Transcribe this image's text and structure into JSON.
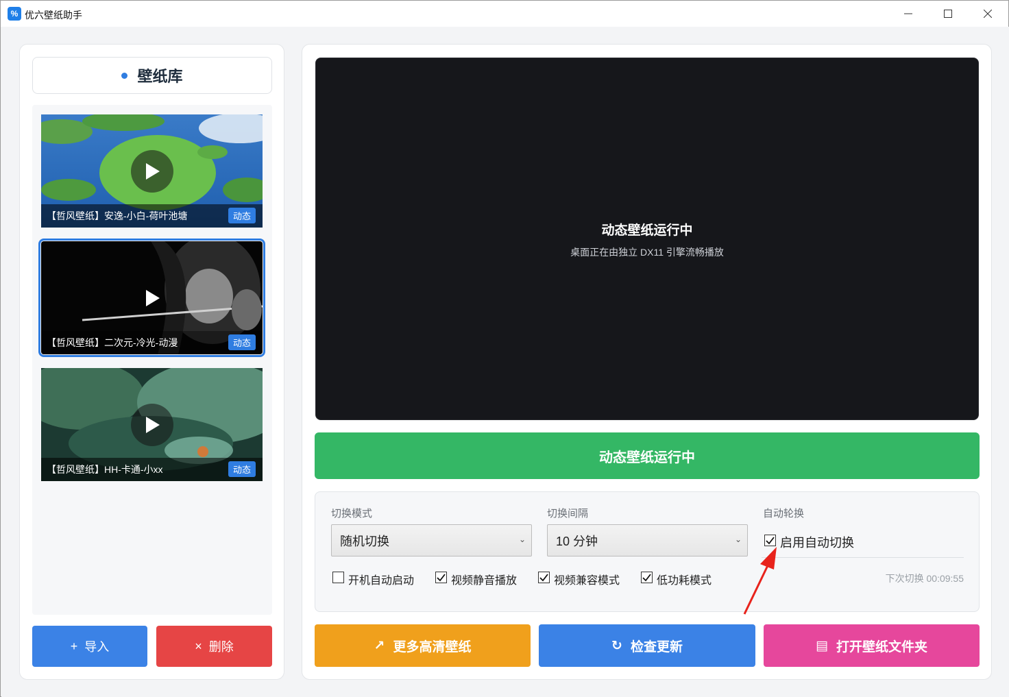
{
  "window": {
    "title": "优六壁纸助手",
    "icon": "app-logo-icon"
  },
  "library": {
    "title": "壁纸库",
    "items": [
      {
        "title": "【哲风壁纸】安逸-小白-荷叶池塘",
        "badge": "动态",
        "selected": false
      },
      {
        "title": "【哲风壁纸】二次元-冷光-动漫",
        "badge": "动态",
        "selected": true
      },
      {
        "title": "【哲风壁纸】HH-卡通-小xx",
        "badge": "动态",
        "selected": false
      }
    ],
    "import_label": "导入",
    "delete_label": "删除"
  },
  "preview": {
    "title": "动态壁纸运行中",
    "subtitle": "桌面正在由独立 DX11 引擎流畅播放"
  },
  "status_bar": {
    "label": "动态壁纸运行中",
    "color": "#34b765"
  },
  "settings": {
    "mode_label": "切换模式",
    "mode_value": "随机切换",
    "interval_label": "切换间隔",
    "interval_value": "10 分钟",
    "auto_label": "自动轮换",
    "auto_enable_label": "启用自动切换",
    "auto_enable_checked": true,
    "options": [
      {
        "label": "开机自动启动",
        "checked": false
      },
      {
        "label": "视频静音播放",
        "checked": true
      },
      {
        "label": "视频兼容模式",
        "checked": true
      },
      {
        "label": "低功耗模式",
        "checked": true
      }
    ],
    "next_switch": "下次切换 00:09:55"
  },
  "actions": {
    "more_label": "更多高清壁纸",
    "update_label": "检查更新",
    "folder_label": "打开壁纸文件夹"
  },
  "colors": {
    "accent": "#3b82e6",
    "danger": "#e64545",
    "warning": "#f0a01c",
    "pink": "#e6479c"
  }
}
